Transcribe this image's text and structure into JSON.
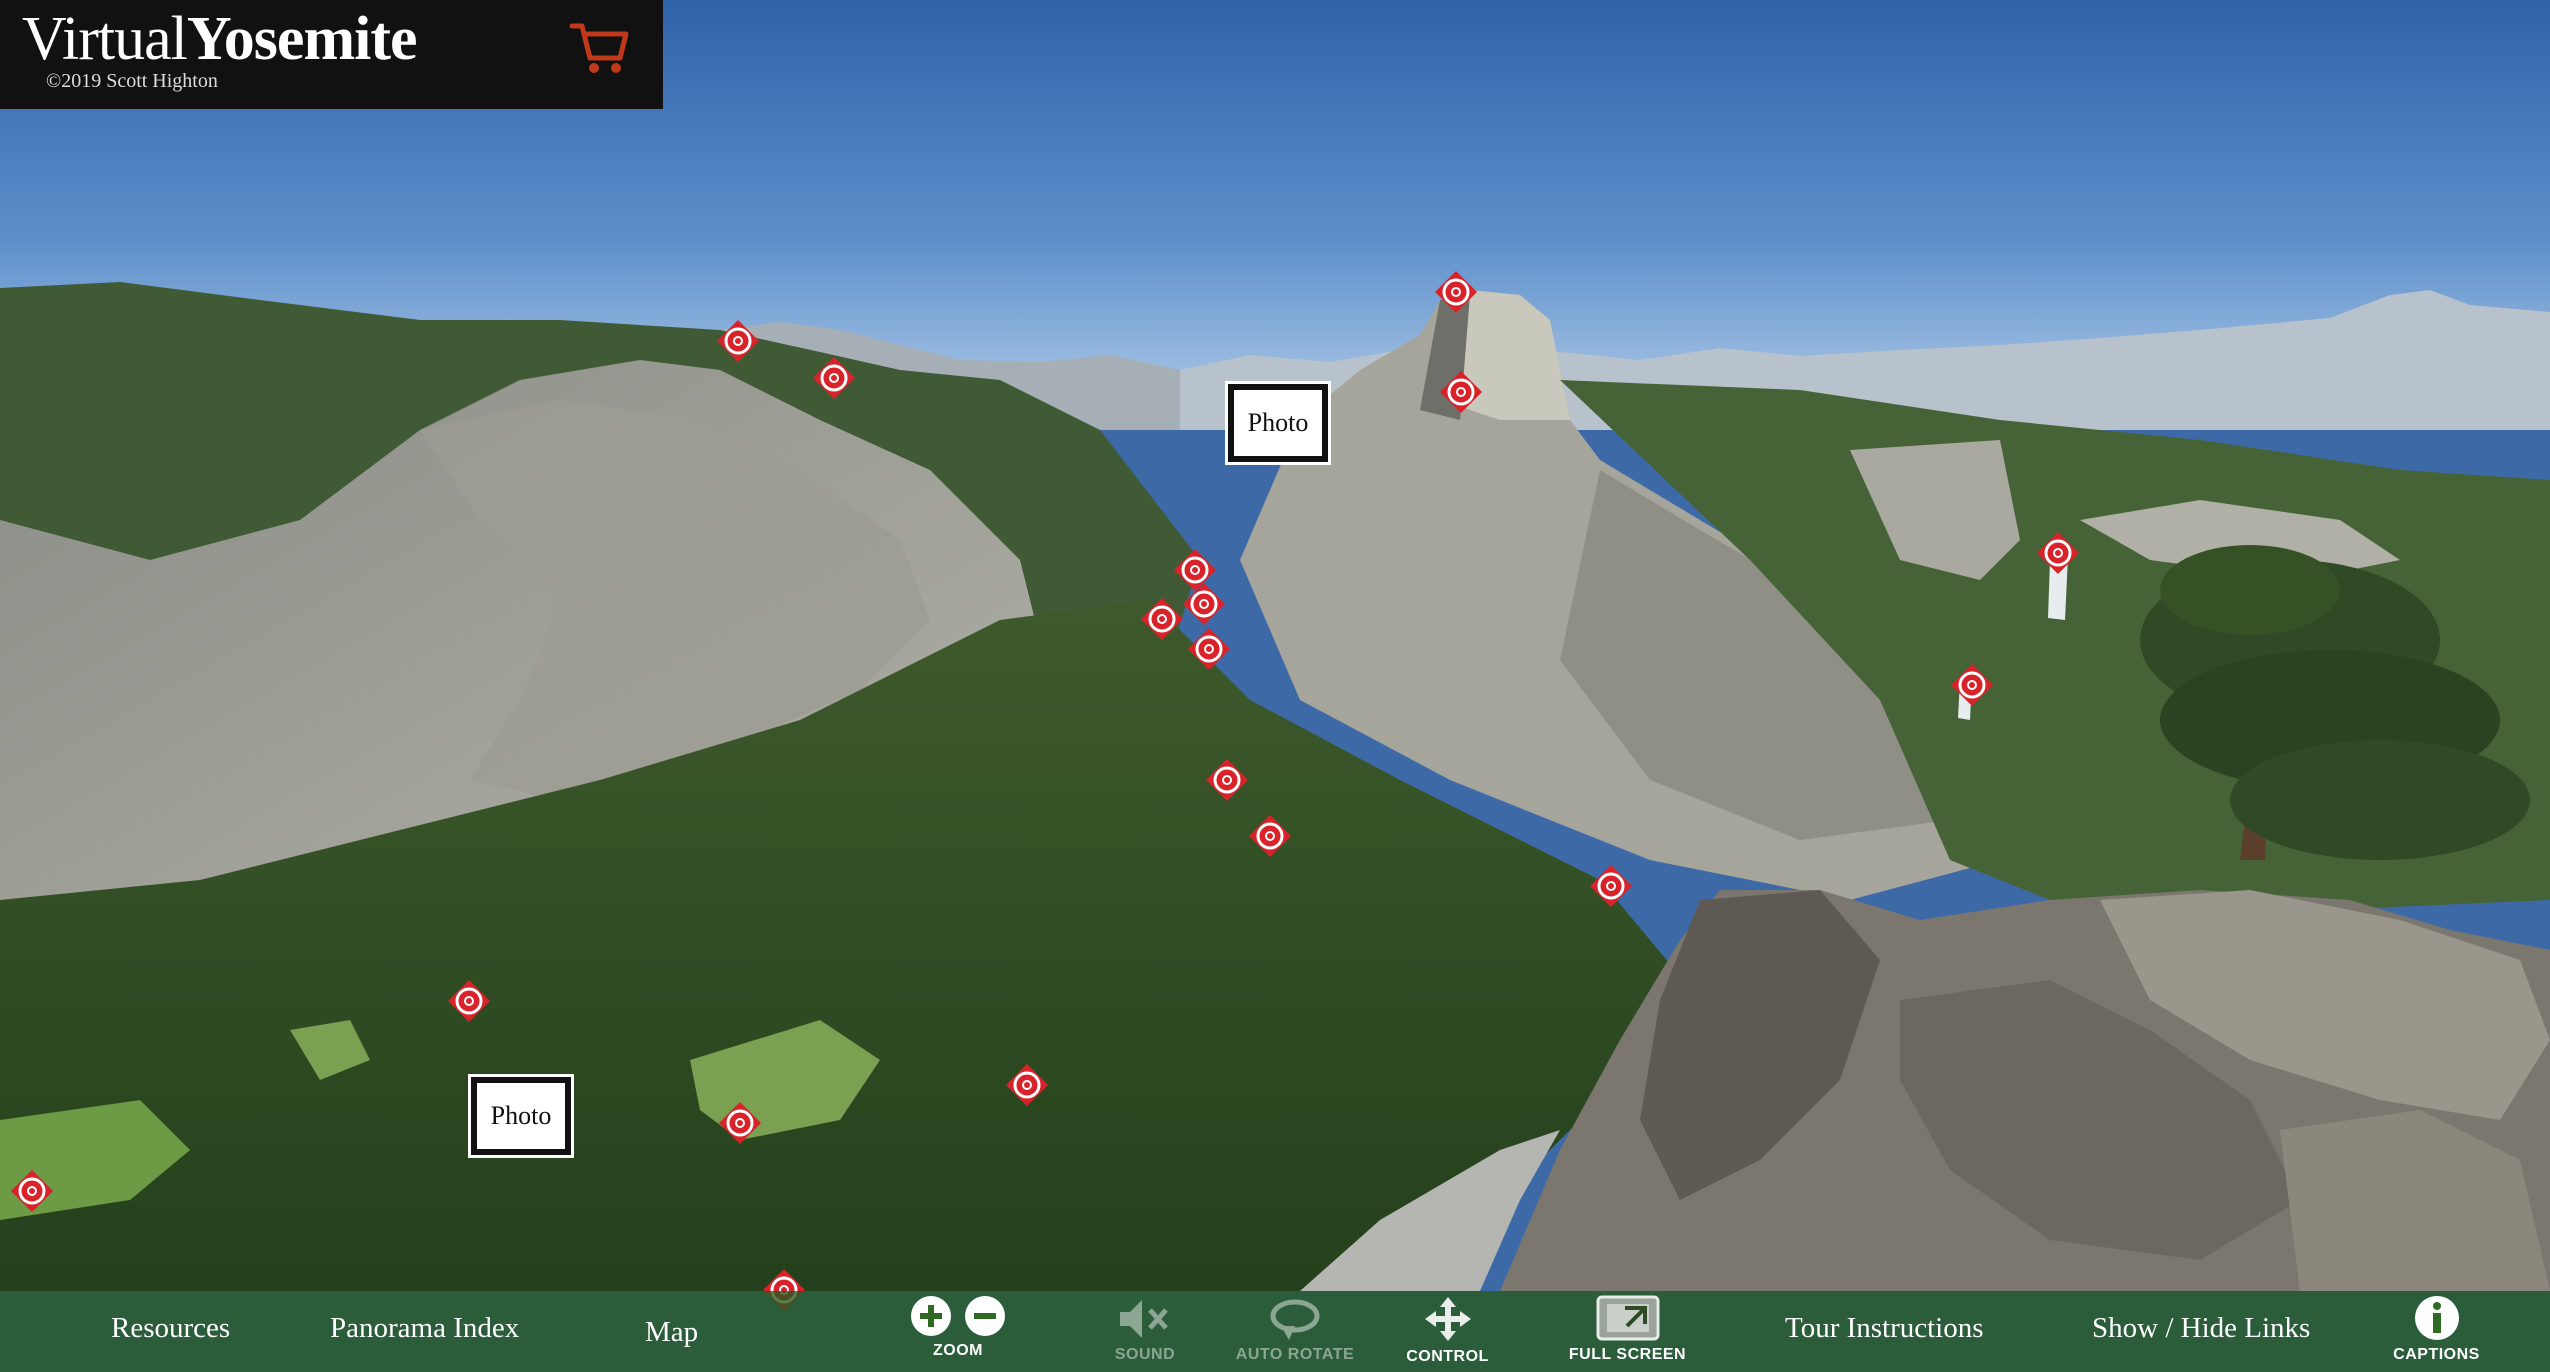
{
  "logo": {
    "title_light": "Virtual",
    "title_bold": "Yosemite",
    "copyright": "©2019 Scott Highton",
    "cart_icon": "shopping-cart-icon"
  },
  "photo_buttons": [
    {
      "label": "Photo"
    },
    {
      "label": "Photo"
    }
  ],
  "hotspot_icon": "target-marker-icon",
  "nav": {
    "resources": "Resources",
    "panorama_index": "Panorama Index",
    "map": "Map",
    "tour_instructions": "Tour Instructions",
    "show_hide_links": "Show / Hide Links"
  },
  "controls": {
    "zoom": "ZOOM",
    "sound": "SOUND",
    "auto_rotate": "AUTO ROTATE",
    "control": "CONTROL",
    "full_screen": "FULL SCREEN",
    "captions": "CAPTIONS"
  },
  "colors": {
    "hotspot": "#d9222a",
    "bar": "#2f6a25",
    "logo_bg": "#111111",
    "cart": "#c0391b"
  }
}
